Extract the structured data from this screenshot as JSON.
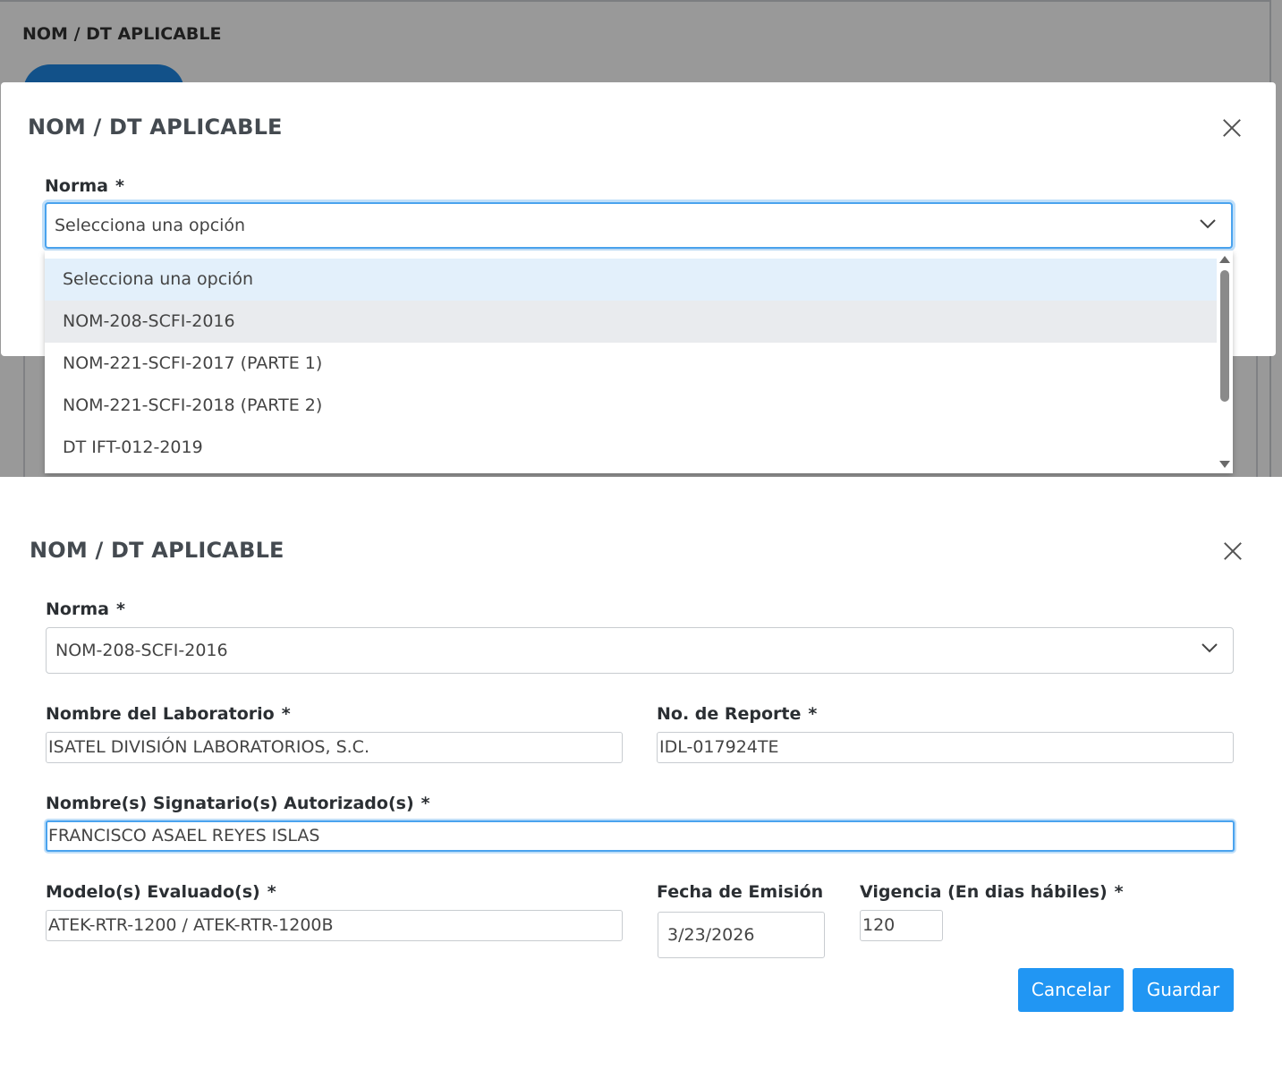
{
  "background_page": {
    "title": "NOM / DT APLICABLE"
  },
  "dropdown_modal": {
    "title": "NOM / DT APLICABLE",
    "norma_label": "Norma",
    "required_mark": "*",
    "select_value": "Selecciona una opción",
    "options": [
      "Selecciona una opción",
      "NOM-208-SCFI-2016",
      "NOM-221-SCFI-2017 (PARTE 1)",
      "NOM-221-SCFI-2018 (PARTE 2)",
      "DT IFT-012-2019"
    ],
    "selected_option_index": 0,
    "hovered_option_index": 1
  },
  "form_modal": {
    "title": "NOM / DT APLICABLE",
    "required_mark": "*",
    "norma": {
      "label": "Norma",
      "value": "NOM-208-SCFI-2016"
    },
    "laboratorio": {
      "label": "Nombre del Laboratorio",
      "value": "ISATEL DIVISIÓN LABORATORIOS, S.C."
    },
    "reporte": {
      "label": "No. de Reporte",
      "value": "IDL-017924TE"
    },
    "signatarios": {
      "label": "Nombre(s) Signatario(s) Autorizado(s)",
      "value": "FRANCISCO ASAEL REYES ISLAS"
    },
    "modelos": {
      "label": "Modelo(s) Evaluado(s)",
      "value": "ATEK-RTR-1200 / ATEK-RTR-1200B"
    },
    "fecha": {
      "label": "Fecha de Emisión",
      "value": "3/23/2026"
    },
    "vigencia": {
      "label": "Vigencia (En dias hábiles)",
      "value": "120"
    },
    "cancel_label": "Cancelar",
    "save_label": "Guardar"
  },
  "colors": {
    "primary_button": "#2196f3",
    "focus_ring": "#4aa3ee",
    "selected_option": "#e3f0fb",
    "hovered_option": "#e9ebee"
  },
  "icons": [
    "close-icon",
    "chevron-down-icon",
    "scroll-up-arrow-icon",
    "scroll-down-arrow-icon"
  ]
}
